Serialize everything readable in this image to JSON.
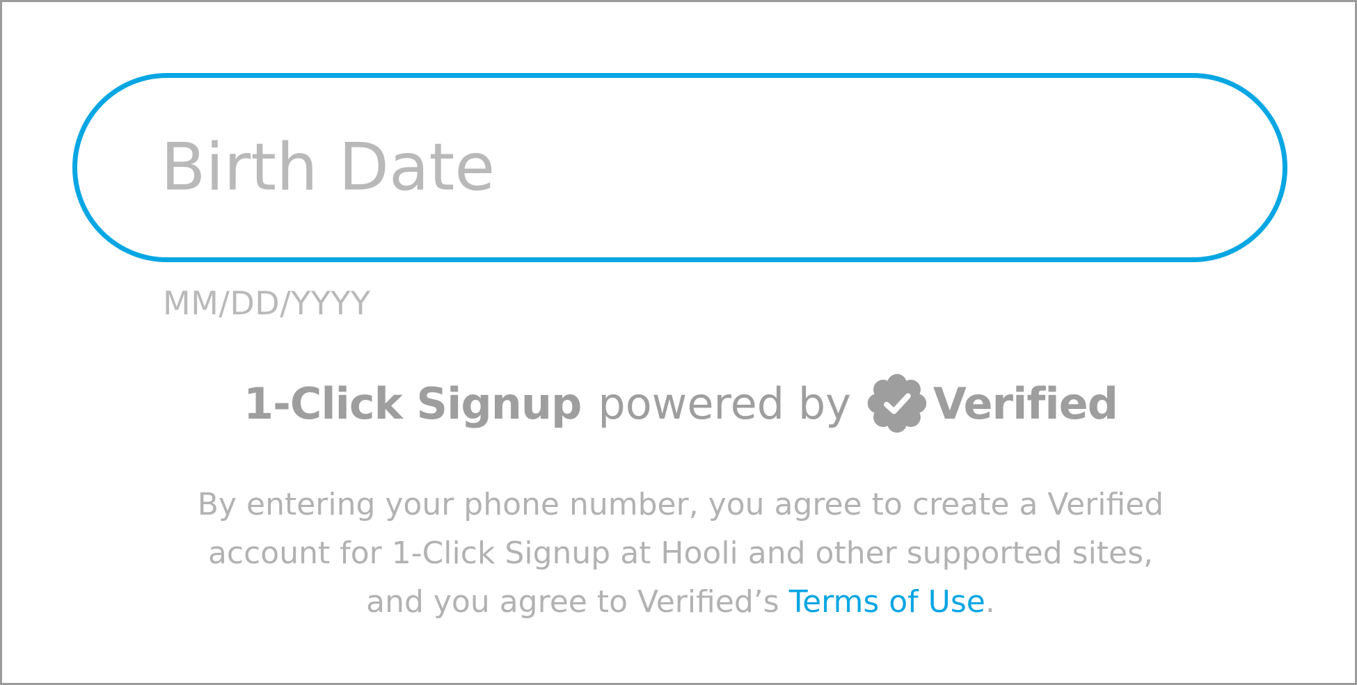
{
  "birth_date": {
    "placeholder": "Birth Date",
    "value": "",
    "format_hint": "MM/DD/YYYY"
  },
  "powered_by": {
    "product": "1-Click Signup",
    "connector": "powered by",
    "brand": "Verified",
    "badge_icon": "verified-badge-icon"
  },
  "terms": {
    "line1": "By entering your phone number, you agree to create a Verified",
    "line2": "account for 1-Click Signup at Hooli and other supported sites,",
    "line3_prefix": "and you agree to Verified’s ",
    "link_label": "Terms of Use",
    "line3_suffix": "."
  },
  "colors": {
    "accent": "#08a6e3",
    "muted_text": "#b2b2b2",
    "brand_gray": "#9e9e9e",
    "frame_border": "#9a9a9a"
  }
}
